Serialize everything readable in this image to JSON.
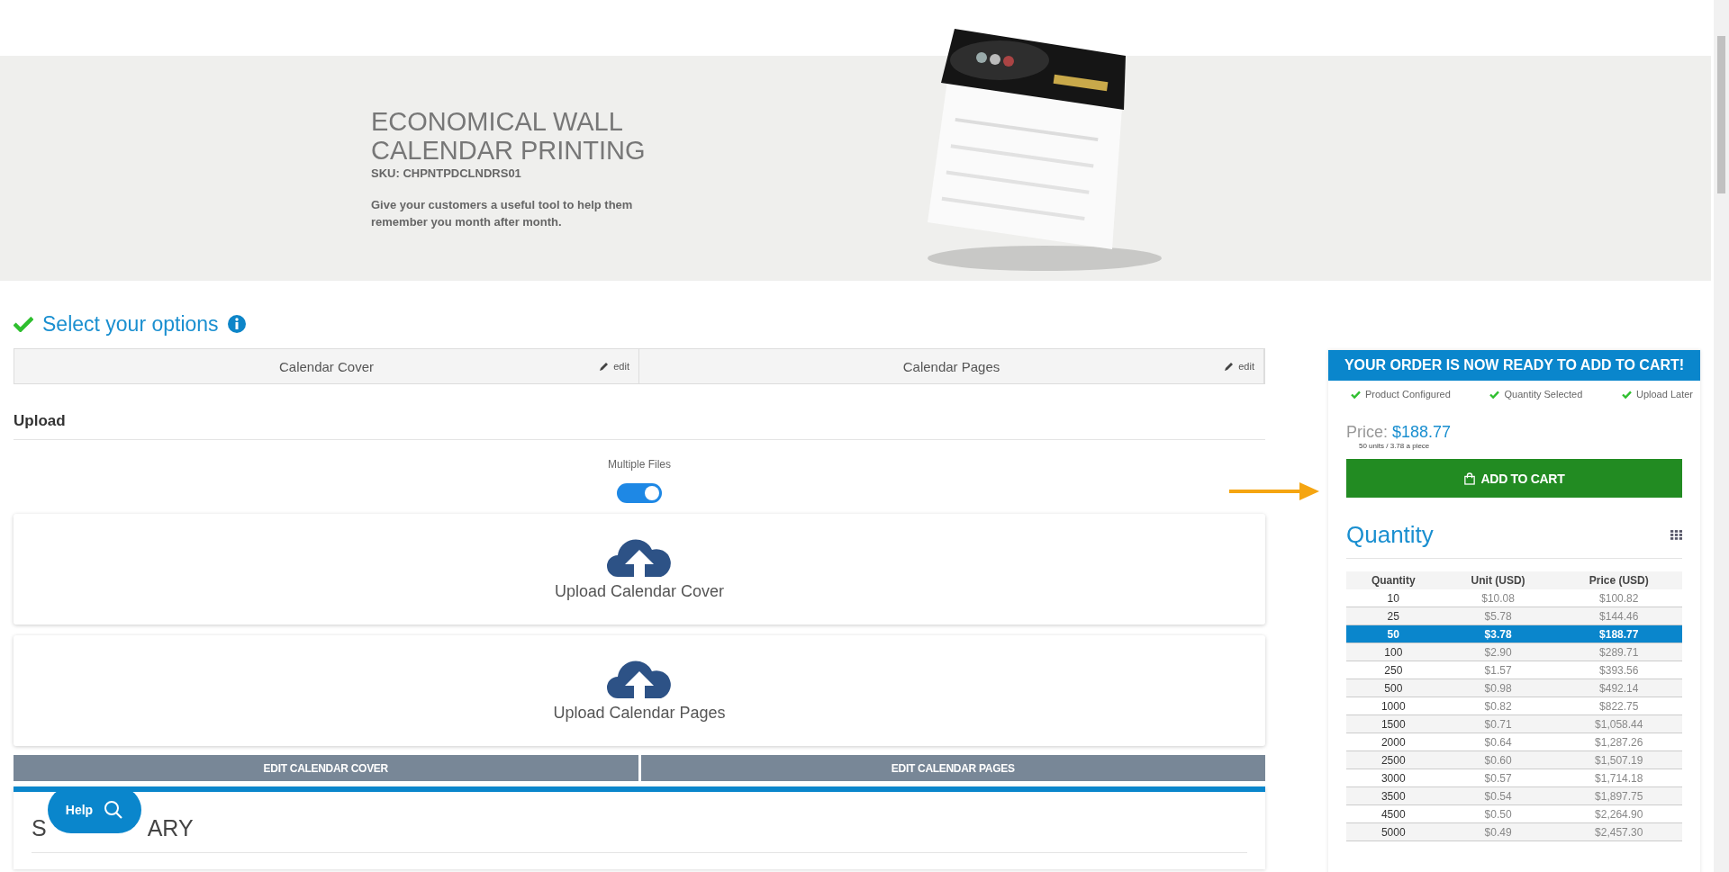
{
  "hero": {
    "title_lines": [
      "ECONOMICAL WALL",
      "CALENDAR PRINTING"
    ],
    "sku": "SKU: CHPNTPDCLNDRS01",
    "description": "Give your customers a useful tool to help them remember you month after month.",
    "image": {
      "kind": "picture"
    }
  },
  "options": {
    "heading": "Select your options",
    "tabs": [
      {
        "label": "Calendar Cover",
        "edit": "edit"
      },
      {
        "label": "Calendar Pages",
        "edit": "edit"
      }
    ]
  },
  "upload": {
    "heading": "Upload",
    "toggle": {
      "label": "Multiple Files",
      "on": true
    },
    "dropzones": [
      "Upload Calendar Cover",
      "Upload Calendar Pages"
    ],
    "edit_buttons": [
      "EDIT CALENDAR COVER",
      "EDIT CALENDAR PAGES"
    ]
  },
  "summary": {
    "heading_parts": [
      "S",
      "ARY"
    ]
  },
  "help_button": {
    "label": "Help"
  },
  "order": {
    "banner": "YOUR ORDER IS NOW READY TO ADD TO CART!",
    "checks": [
      "Product Configured",
      "Quantity Selected",
      "Upload Later"
    ],
    "price_label": "Price:",
    "price": "$188.77",
    "price_note": "50 units / 3.78 a piece",
    "add_to_cart": "ADD TO CART",
    "quantity_heading": "Quantity",
    "table": {
      "columns": [
        "Quantity",
        "Unit (USD)",
        "Price (USD)"
      ],
      "rows": [
        {
          "cells": [
            "10",
            "$10.08",
            "$100.82"
          ],
          "selected": false
        },
        {
          "cells": [
            "25",
            "$5.78",
            "$144.46"
          ],
          "selected": false
        },
        {
          "cells": [
            "50",
            "$3.78",
            "$188.77"
          ],
          "selected": true
        },
        {
          "cells": [
            "100",
            "$2.90",
            "$289.71"
          ],
          "selected": false
        },
        {
          "cells": [
            "250",
            "$1.57",
            "$393.56"
          ],
          "selected": false
        },
        {
          "cells": [
            "500",
            "$0.98",
            "$492.14"
          ],
          "selected": false
        },
        {
          "cells": [
            "1000",
            "$0.82",
            "$822.75"
          ],
          "selected": false
        },
        {
          "cells": [
            "1500",
            "$0.71",
            "$1,058.44"
          ],
          "selected": false
        },
        {
          "cells": [
            "2000",
            "$0.64",
            "$1,287.26"
          ],
          "selected": false
        },
        {
          "cells": [
            "2500",
            "$0.60",
            "$1,507.19"
          ],
          "selected": false
        },
        {
          "cells": [
            "3000",
            "$0.57",
            "$1,714.18"
          ],
          "selected": false
        },
        {
          "cells": [
            "3500",
            "$0.54",
            "$1,897.75"
          ],
          "selected": false
        },
        {
          "cells": [
            "4500",
            "$0.50",
            "$2,264.90"
          ],
          "selected": false
        },
        {
          "cells": [
            "5000",
            "$0.49",
            "$2,457.30"
          ],
          "selected": false
        }
      ]
    }
  }
}
